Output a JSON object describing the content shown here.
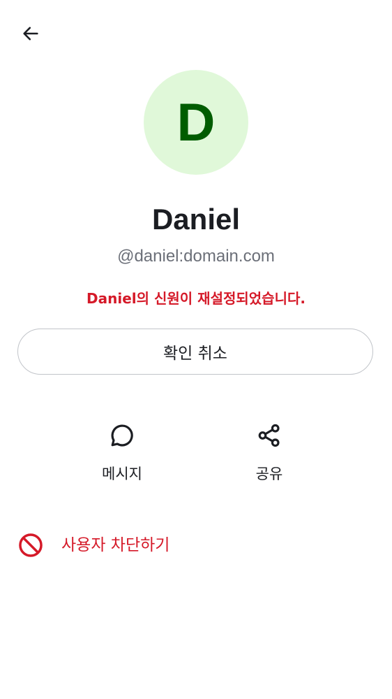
{
  "colors": {
    "text_primary": "#1b1d22",
    "text_secondary": "#6b6f78",
    "critical": "#d51928",
    "avatar_bg": "#e0f8d9",
    "avatar_fg": "#005c00",
    "border": "#c1c4c9"
  },
  "header": {
    "back_icon": "arrow-left-icon"
  },
  "profile": {
    "avatar_letter": "D",
    "display_name": "Daniel",
    "user_id": "@daniel:domain.com",
    "identity_warning": "Daniel의 신원이 재설정되었습니다."
  },
  "buttons": {
    "withdraw_verification_label": "확인 취소"
  },
  "actions": {
    "message": {
      "label": "메시지",
      "icon": "chat-bubble-icon"
    },
    "share": {
      "label": "공유",
      "icon": "share-icon"
    }
  },
  "block": {
    "label": "사용자 차단하기",
    "icon": "block-icon"
  }
}
